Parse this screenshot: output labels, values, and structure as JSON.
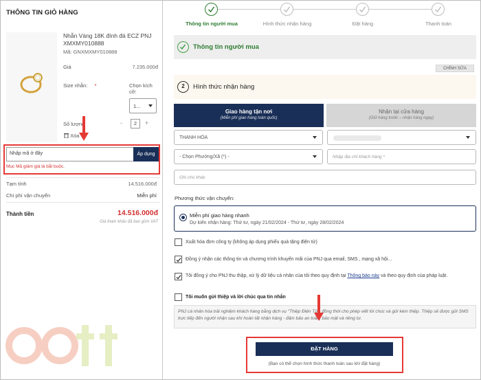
{
  "cart": {
    "title": "THÔNG TIN GIỎ HÀNG",
    "product_name": "Nhẫn Vàng 18K đính đá ECZ PNJ XMXMY010888",
    "sku_label": "Mã: GNXMXMY010888",
    "price_label": "Giá",
    "price_value": "7.235.000đ",
    "size_label": "Size nhẫn:",
    "size_required": "*",
    "size_hint": "Chọn kích cỡ:",
    "size_value": "1...",
    "qty_label": "Số lượng",
    "qty_minus": "-",
    "qty_value": "2",
    "qty_plus": "+",
    "delete_label": "Xóa",
    "coupon_placeholder": "Nhập mã ở đây",
    "coupon_button": "Áp dụng",
    "coupon_error": "Mục Mã giảm giá là bắt buộc.",
    "subtotal_label": "Tạm tính",
    "subtotal_value": "14.516.000đ",
    "shipping_label": "Chi phí vận chuyển",
    "shipping_value": "Miễn phí",
    "total_label": "Thành tiền",
    "total_value": "14.516.000đ",
    "vat_note": "Giá tham khảo đã bao gồm VAT"
  },
  "steps": [
    {
      "label": "Thông tin người mua",
      "done": true
    },
    {
      "label": "Hình thức nhận hàng",
      "done": true
    },
    {
      "label": "Đặt hàng",
      "done": true
    },
    {
      "label": "Thanh toán",
      "done": true
    }
  ],
  "buyer_section": {
    "title": "Thông tin người mua",
    "edit_label": "CHỈNH SỬA"
  },
  "delivery_section": {
    "number": "2",
    "title": "Hình thức nhận hàng",
    "tab_home_title": "Giao hàng tận nơi",
    "tab_home_sub": "(Miễn phí giao hàng toàn quốc)",
    "tab_store_title": "Nhận tại cửa hàng",
    "tab_store_sub": "(Giữ hàng trước – nhận hàng ngay)",
    "province_value": "THANH HÓA",
    "ward_value": "- Chọn Phường/Xã (*) -",
    "address_placeholder": "Nhập địa chỉ khách hàng *",
    "note_placeholder": "Ghi chú khác"
  },
  "shipping": {
    "title": "Phương thức vận chuyển:",
    "option_name": "Miễn phí giao hàng nhanh",
    "option_date": "Dự kiến nhận hàng: Thứ tư, ngày 21/02/2024 - Thứ tư, ngày 28/02/2024"
  },
  "checkboxes": {
    "invoice": "Xuất hóa đơn công ty (không áp dụng phiếu quà tặng điện tử)",
    "promo": "Đồng ý nhận các thông tin và chương trình khuyến mãi của PNJ qua email, SMS , mạng xã hội...",
    "privacy_1": "Tôi đồng ý cho PNJ thu thập, xử lý dữ liệu cá nhân của tôi theo quy định tại",
    "privacy_link": "Thông báo này",
    "privacy_2": "và theo quy định của pháp luật.",
    "greeting": "Tôi muốn gửi thiệp và lời chúc qua tin nhắn"
  },
  "greeting_note": "PNJ cá nhân hóa trải nghiệm khách hàng bằng dịch vụ \"Thiệp Điện Tử\", đồng thời cho phép viết lời chúc và gửi kèm thiệp. Thiệp sẽ được gửi SMS trực tiếp đến người nhận sau khi hoàn tất nhận hàng - đảm bảo an toàn, bảo mật và riêng tư.",
  "order": {
    "button": "ĐẶT HÀNG",
    "note": "(Bạn có thể chọn hình thức thanh toán sau khi đặt hàng)"
  },
  "colors": {
    "navy": "#1a2f57",
    "green": "#2e7d32",
    "red": "#e53935",
    "total_red": "#d32f2f"
  },
  "icons": [
    "ring-product-image",
    "check-icon",
    "trash-icon",
    "chevron-down-icon",
    "down-arrow-annotation",
    "gott-watermark"
  ]
}
